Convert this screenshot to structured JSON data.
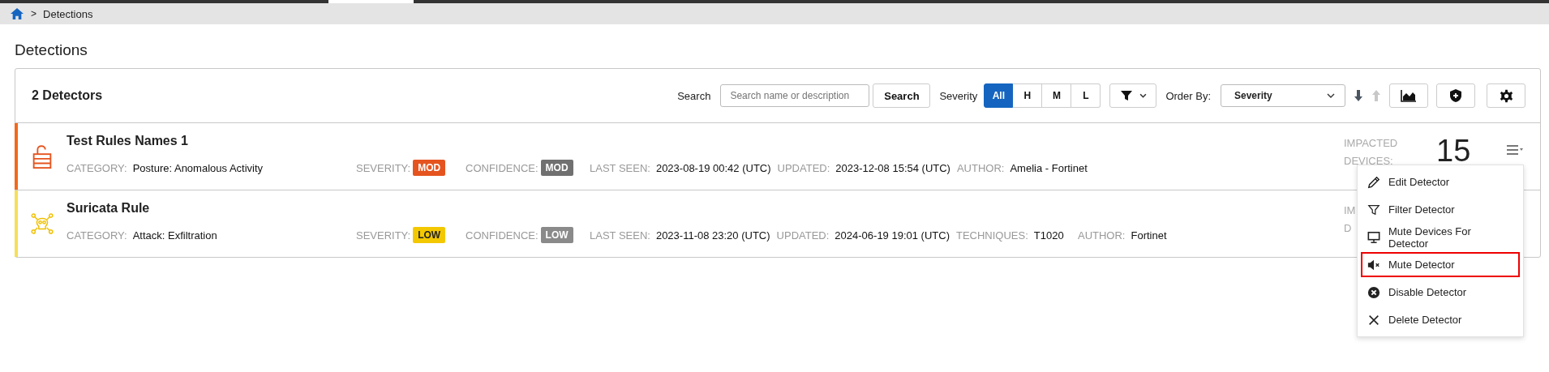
{
  "breadcrumb": {
    "items": [
      "Detections"
    ],
    "separator": ">"
  },
  "page_title": "Detections",
  "toolbar": {
    "count": "2 Detectors",
    "search_label": "Search",
    "search": {
      "placeholder": "Search name or description"
    },
    "search_button": "Search",
    "severity_label": "Severity",
    "severity_filters": [
      {
        "label": "All",
        "selected": true
      },
      {
        "label": "H",
        "selected": false
      },
      {
        "label": "M",
        "selected": false
      },
      {
        "label": "L",
        "selected": false
      }
    ],
    "order_by_label": "Order By:",
    "order_by": {
      "value": "Severity"
    }
  },
  "detectors": [
    {
      "title": "Test Rules Names 1",
      "color": "#f26a1b",
      "fields": [
        {
          "label": "CATEGORY:",
          "value": "Posture: Anomalous Activity",
          "kind": "text"
        },
        {
          "label": "SEVERITY:",
          "value": "MOD",
          "kind": "badge",
          "color": "#e5541f"
        },
        {
          "label": "CONFIDENCE:",
          "value": "MOD",
          "kind": "badge",
          "color": "#707070"
        },
        {
          "label": "LAST SEEN:",
          "value": "2023-08-19 00:42 (UTC)",
          "kind": "text"
        },
        {
          "label": "UPDATED:",
          "value": "2023-12-08 15:54 (UTC)",
          "kind": "text"
        },
        {
          "label": "AUTHOR:",
          "value": "Amelia - Fortinet",
          "kind": "text"
        }
      ],
      "impacted_label": [
        "IMPACTED",
        "DEVICES:"
      ],
      "impacted_count": "15"
    },
    {
      "title": "Suricata Rule",
      "color": "#f5e05a",
      "fields": [
        {
          "label": "CATEGORY:",
          "value": "Attack: Exfiltration",
          "kind": "text"
        },
        {
          "label": "SEVERITY:",
          "value": "LOW",
          "kind": "badge",
          "color": "#f3c800"
        },
        {
          "label": "CONFIDENCE:",
          "value": "LOW",
          "kind": "badge",
          "color": "#8a8a8a"
        },
        {
          "label": "LAST SEEN:",
          "value": "2023-11-08 23:20 (UTC)",
          "kind": "text"
        },
        {
          "label": "UPDATED:",
          "value": "2024-06-19 19:01 (UTC)",
          "kind": "text"
        },
        {
          "label": "TECHNIQUES:",
          "value": "T1020",
          "kind": "text"
        },
        {
          "label": "AUTHOR:",
          "value": "Fortinet",
          "kind": "text"
        }
      ],
      "impacted_label": [
        "IM",
        "D"
      ]
    }
  ],
  "context_menu": [
    {
      "label": "Edit Detector",
      "kind": "edit",
      "highlighted": false
    },
    {
      "label": "Filter Detector",
      "kind": "filter",
      "highlighted": false
    },
    {
      "label": "Mute Devices For Detector",
      "kind": "monitor",
      "highlighted": false
    },
    {
      "label": "Mute Detector",
      "kind": "mute",
      "highlighted": true
    },
    {
      "label": "Disable Detector",
      "kind": "disable",
      "highlighted": false
    },
    {
      "label": "Delete Detector",
      "kind": "delete",
      "highlighted": false
    }
  ]
}
